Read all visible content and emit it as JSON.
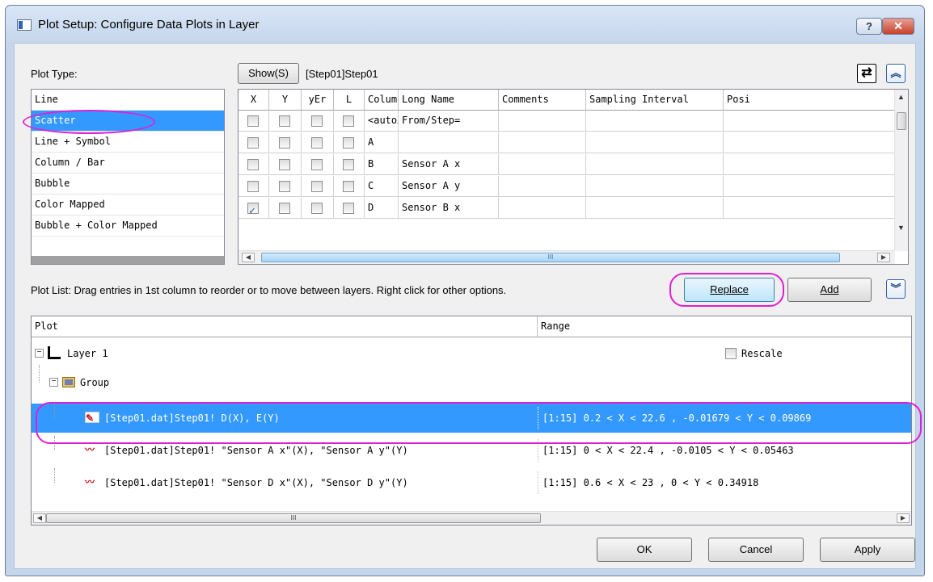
{
  "window": {
    "title": "Plot Setup: Configure Data Plots in Layer",
    "help_label": "?",
    "close_label": "✕"
  },
  "plot_type": {
    "label": "Plot Type:",
    "items": [
      "Line",
      "Scatter",
      "Line + Symbol",
      "Column / Bar",
      "Bubble",
      "Color Mapped",
      "Bubble + Color Mapped"
    ],
    "selected": "Scatter"
  },
  "toolbar": {
    "show_label": "Show(S)",
    "source_label": "[Step01]Step01"
  },
  "columns_grid": {
    "headers": [
      "X",
      "Y",
      "yEr",
      "L",
      "Column",
      "Long Name",
      "Comments",
      "Sampling Interval",
      "Posi"
    ],
    "rows": [
      {
        "x": false,
        "y": false,
        "yer": false,
        "l": false,
        "column": "<autoX>",
        "long_name": "From/Step="
      },
      {
        "x": false,
        "y": false,
        "yer": false,
        "l": false,
        "column": "A",
        "long_name": ""
      },
      {
        "x": false,
        "y": false,
        "yer": false,
        "l": false,
        "column": "B",
        "long_name": "Sensor A x"
      },
      {
        "x": false,
        "y": false,
        "yer": false,
        "l": false,
        "column": "C",
        "long_name": "Sensor A y"
      },
      {
        "x": true,
        "y": false,
        "yer": false,
        "l": false,
        "column": "D",
        "long_name": "Sensor B x"
      }
    ],
    "h_thumb_label": "III"
  },
  "plot_list": {
    "instruction": "Plot List: Drag entries in 1st column to reorder or to move between layers. Right click for other options.",
    "replace_label": "Replace",
    "add_label": "Add",
    "headers": [
      "Plot",
      "Range"
    ],
    "layer_label": "Layer 1",
    "rescale_label": "Rescale",
    "group_label": "Group",
    "entries": [
      {
        "plot": "[Step01.dat]Step01! D(X), E(Y)",
        "range": "[1:15]  0.2 < X < 22.6 , -0.01679 < Y < 0.09869",
        "selected": true
      },
      {
        "plot": "[Step01.dat]Step01! \"Sensor A x\"(X), \"Sensor A y\"(Y)",
        "range": "[1:15]  0 < X < 22.4 , -0.0105 < Y < 0.05463",
        "selected": false
      },
      {
        "plot": "[Step01.dat]Step01! \"Sensor D x\"(X), \"Sensor D y\"(Y)",
        "range": "[1:15]  0.6 < X < 23 , 0 < Y < 0.34918",
        "selected": false
      }
    ],
    "h_thumb_label": "III"
  },
  "footer": {
    "ok_label": "OK",
    "cancel_label": "Cancel",
    "apply_label": "Apply"
  },
  "colors": {
    "selection": "#3399ff",
    "annotation": "#e01fd3",
    "title_bar": "#c5d6ec"
  }
}
